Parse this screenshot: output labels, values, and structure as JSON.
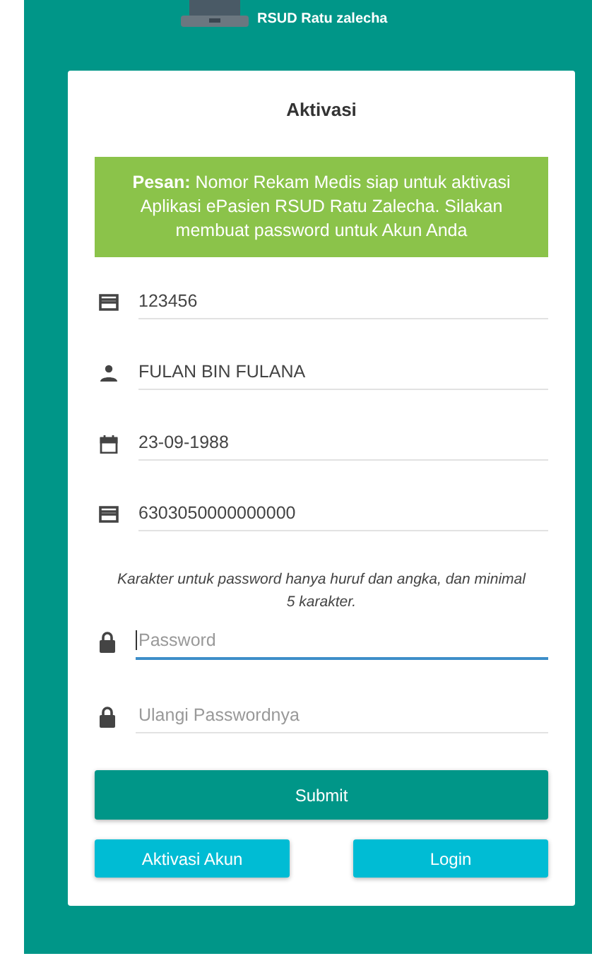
{
  "header": {
    "subtitle": "RSUD Ratu zalecha"
  },
  "card": {
    "title": "Aktivasi",
    "message": "**Pesan:** Nomor Rekam Medis siap untuk aktivasi Aplikasi ePasien RSUD Ratu Zalecha. Silakan membuat password untuk Akun Anda",
    "fields": [
      {
        "kind": "card",
        "value": "123456",
        "focused": false
      },
      {
        "kind": "person",
        "value": "FULAN BIN FULANA",
        "focused": false
      },
      {
        "kind": "calendar",
        "value": "23-09-1988",
        "focused": false
      },
      {
        "kind": "card",
        "value": "6303050000000000",
        "focused": false
      }
    ],
    "hint": "Karakter untuk password hanya huruf dan angka, dan minimal 5 karakter.",
    "password_fields": [
      {
        "kind": "lock",
        "placeholder": "Password",
        "focused": true
      },
      {
        "kind": "lock",
        "placeholder": "Ulangi Passwordnya",
        "focused": false
      }
    ],
    "submit": "Submit",
    "buttons": [
      "Aktivasi Akun",
      "Login"
    ]
  }
}
